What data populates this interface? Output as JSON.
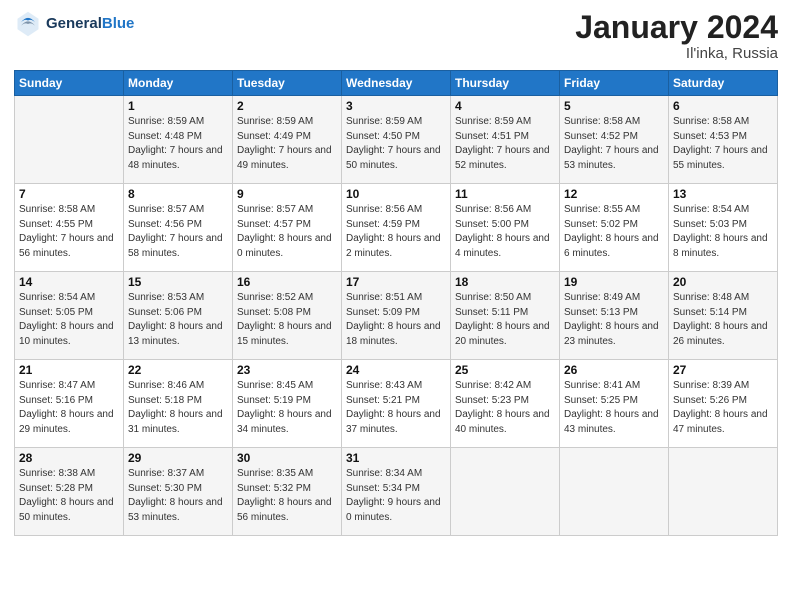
{
  "header": {
    "logo_line1": "General",
    "logo_line2": "Blue",
    "month_title": "January 2024",
    "subtitle": "Il'inka, Russia"
  },
  "days_of_week": [
    "Sunday",
    "Monday",
    "Tuesday",
    "Wednesday",
    "Thursday",
    "Friday",
    "Saturday"
  ],
  "weeks": [
    [
      {
        "day": "",
        "sunrise": "",
        "sunset": "",
        "daylight": ""
      },
      {
        "day": "1",
        "sunrise": "Sunrise: 8:59 AM",
        "sunset": "Sunset: 4:48 PM",
        "daylight": "Daylight: 7 hours and 48 minutes."
      },
      {
        "day": "2",
        "sunrise": "Sunrise: 8:59 AM",
        "sunset": "Sunset: 4:49 PM",
        "daylight": "Daylight: 7 hours and 49 minutes."
      },
      {
        "day": "3",
        "sunrise": "Sunrise: 8:59 AM",
        "sunset": "Sunset: 4:50 PM",
        "daylight": "Daylight: 7 hours and 50 minutes."
      },
      {
        "day": "4",
        "sunrise": "Sunrise: 8:59 AM",
        "sunset": "Sunset: 4:51 PM",
        "daylight": "Daylight: 7 hours and 52 minutes."
      },
      {
        "day": "5",
        "sunrise": "Sunrise: 8:58 AM",
        "sunset": "Sunset: 4:52 PM",
        "daylight": "Daylight: 7 hours and 53 minutes."
      },
      {
        "day": "6",
        "sunrise": "Sunrise: 8:58 AM",
        "sunset": "Sunset: 4:53 PM",
        "daylight": "Daylight: 7 hours and 55 minutes."
      }
    ],
    [
      {
        "day": "7",
        "sunrise": "Sunrise: 8:58 AM",
        "sunset": "Sunset: 4:55 PM",
        "daylight": "Daylight: 7 hours and 56 minutes."
      },
      {
        "day": "8",
        "sunrise": "Sunrise: 8:57 AM",
        "sunset": "Sunset: 4:56 PM",
        "daylight": "Daylight: 7 hours and 58 minutes."
      },
      {
        "day": "9",
        "sunrise": "Sunrise: 8:57 AM",
        "sunset": "Sunset: 4:57 PM",
        "daylight": "Daylight: 8 hours and 0 minutes."
      },
      {
        "day": "10",
        "sunrise": "Sunrise: 8:56 AM",
        "sunset": "Sunset: 4:59 PM",
        "daylight": "Daylight: 8 hours and 2 minutes."
      },
      {
        "day": "11",
        "sunrise": "Sunrise: 8:56 AM",
        "sunset": "Sunset: 5:00 PM",
        "daylight": "Daylight: 8 hours and 4 minutes."
      },
      {
        "day": "12",
        "sunrise": "Sunrise: 8:55 AM",
        "sunset": "Sunset: 5:02 PM",
        "daylight": "Daylight: 8 hours and 6 minutes."
      },
      {
        "day": "13",
        "sunrise": "Sunrise: 8:54 AM",
        "sunset": "Sunset: 5:03 PM",
        "daylight": "Daylight: 8 hours and 8 minutes."
      }
    ],
    [
      {
        "day": "14",
        "sunrise": "Sunrise: 8:54 AM",
        "sunset": "Sunset: 5:05 PM",
        "daylight": "Daylight: 8 hours and 10 minutes."
      },
      {
        "day": "15",
        "sunrise": "Sunrise: 8:53 AM",
        "sunset": "Sunset: 5:06 PM",
        "daylight": "Daylight: 8 hours and 13 minutes."
      },
      {
        "day": "16",
        "sunrise": "Sunrise: 8:52 AM",
        "sunset": "Sunset: 5:08 PM",
        "daylight": "Daylight: 8 hours and 15 minutes."
      },
      {
        "day": "17",
        "sunrise": "Sunrise: 8:51 AM",
        "sunset": "Sunset: 5:09 PM",
        "daylight": "Daylight: 8 hours and 18 minutes."
      },
      {
        "day": "18",
        "sunrise": "Sunrise: 8:50 AM",
        "sunset": "Sunset: 5:11 PM",
        "daylight": "Daylight: 8 hours and 20 minutes."
      },
      {
        "day": "19",
        "sunrise": "Sunrise: 8:49 AM",
        "sunset": "Sunset: 5:13 PM",
        "daylight": "Daylight: 8 hours and 23 minutes."
      },
      {
        "day": "20",
        "sunrise": "Sunrise: 8:48 AM",
        "sunset": "Sunset: 5:14 PM",
        "daylight": "Daylight: 8 hours and 26 minutes."
      }
    ],
    [
      {
        "day": "21",
        "sunrise": "Sunrise: 8:47 AM",
        "sunset": "Sunset: 5:16 PM",
        "daylight": "Daylight: 8 hours and 29 minutes."
      },
      {
        "day": "22",
        "sunrise": "Sunrise: 8:46 AM",
        "sunset": "Sunset: 5:18 PM",
        "daylight": "Daylight: 8 hours and 31 minutes."
      },
      {
        "day": "23",
        "sunrise": "Sunrise: 8:45 AM",
        "sunset": "Sunset: 5:19 PM",
        "daylight": "Daylight: 8 hours and 34 minutes."
      },
      {
        "day": "24",
        "sunrise": "Sunrise: 8:43 AM",
        "sunset": "Sunset: 5:21 PM",
        "daylight": "Daylight: 8 hours and 37 minutes."
      },
      {
        "day": "25",
        "sunrise": "Sunrise: 8:42 AM",
        "sunset": "Sunset: 5:23 PM",
        "daylight": "Daylight: 8 hours and 40 minutes."
      },
      {
        "day": "26",
        "sunrise": "Sunrise: 8:41 AM",
        "sunset": "Sunset: 5:25 PM",
        "daylight": "Daylight: 8 hours and 43 minutes."
      },
      {
        "day": "27",
        "sunrise": "Sunrise: 8:39 AM",
        "sunset": "Sunset: 5:26 PM",
        "daylight": "Daylight: 8 hours and 47 minutes."
      }
    ],
    [
      {
        "day": "28",
        "sunrise": "Sunrise: 8:38 AM",
        "sunset": "Sunset: 5:28 PM",
        "daylight": "Daylight: 8 hours and 50 minutes."
      },
      {
        "day": "29",
        "sunrise": "Sunrise: 8:37 AM",
        "sunset": "Sunset: 5:30 PM",
        "daylight": "Daylight: 8 hours and 53 minutes."
      },
      {
        "day": "30",
        "sunrise": "Sunrise: 8:35 AM",
        "sunset": "Sunset: 5:32 PM",
        "daylight": "Daylight: 8 hours and 56 minutes."
      },
      {
        "day": "31",
        "sunrise": "Sunrise: 8:34 AM",
        "sunset": "Sunset: 5:34 PM",
        "daylight": "Daylight: 9 hours and 0 minutes."
      },
      {
        "day": "",
        "sunrise": "",
        "sunset": "",
        "daylight": ""
      },
      {
        "day": "",
        "sunrise": "",
        "sunset": "",
        "daylight": ""
      },
      {
        "day": "",
        "sunrise": "",
        "sunset": "",
        "daylight": ""
      }
    ]
  ]
}
